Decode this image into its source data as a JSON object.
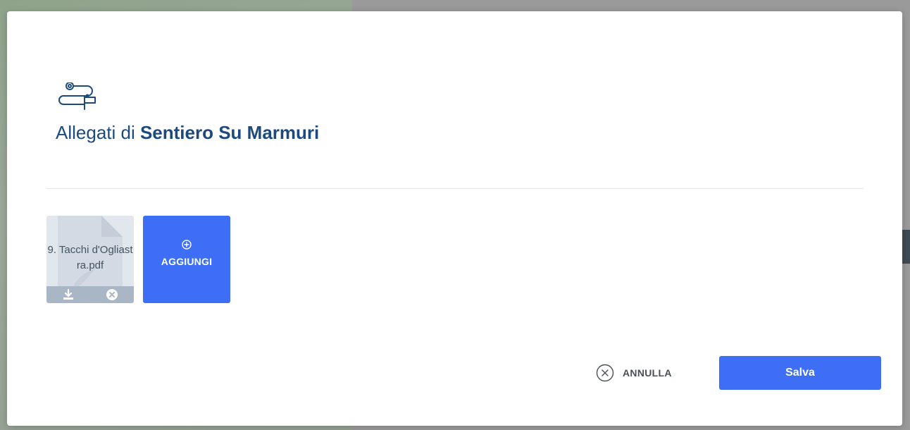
{
  "modal": {
    "title_prefix": "Allegati di",
    "title_name": "Sentiero Su Marmuri"
  },
  "attachments": [
    {
      "file_name": "9. Tacchi d'Ogliastra.pdf"
    }
  ],
  "add_button": {
    "label": "AGGIUNGI"
  },
  "footer": {
    "cancel_label": "ANNULLA",
    "save_label": "Salva"
  },
  "colors": {
    "primary": "#3d6ef5",
    "title": "#1d4a7e"
  },
  "icons": {
    "header": "route-icon",
    "add": "plus-circle-icon",
    "download": "download-icon",
    "remove": "close-circle-icon",
    "cancel": "close-circle-icon"
  }
}
